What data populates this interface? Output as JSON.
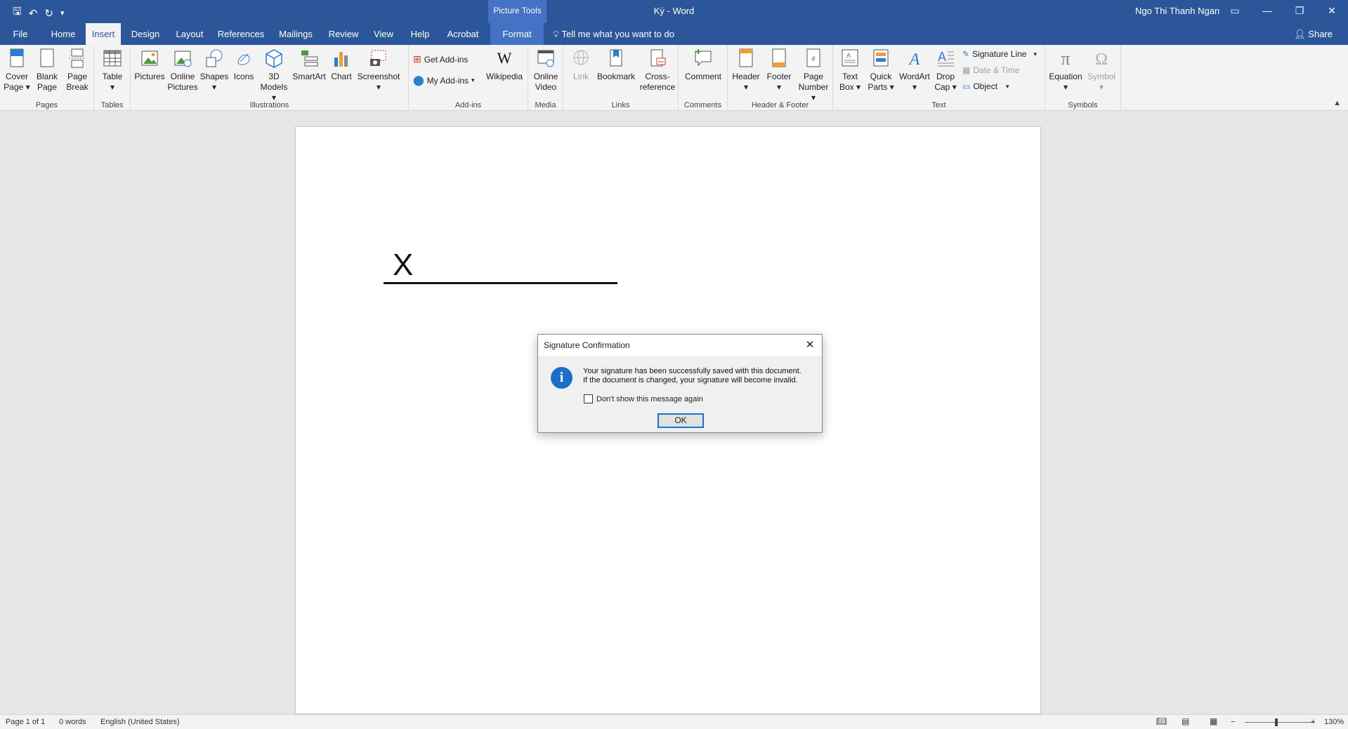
{
  "titlebar": {
    "contextual_tab_group": "Picture Tools",
    "doc_title": "Ký  -  Word",
    "user": "Ngo Thi Thanh Ngan"
  },
  "tabs": [
    "File",
    "Home",
    "Insert",
    "Design",
    "Layout",
    "References",
    "Mailings",
    "Review",
    "View",
    "Help",
    "Acrobat",
    "Format"
  ],
  "active_tab": "Insert",
  "tell_me": "Tell me what you want to do",
  "share": "Share",
  "ribbon": {
    "pages": {
      "label": "Pages",
      "cover": [
        "Cover",
        "Page"
      ],
      "blank": [
        "Blank",
        "Page"
      ],
      "break": [
        "Page",
        "Break"
      ]
    },
    "tables": {
      "label": "Tables",
      "table": "Table"
    },
    "illustrations": {
      "label": "Illustrations",
      "pictures": "Pictures",
      "online": [
        "Online",
        "Pictures"
      ],
      "shapes": "Shapes",
      "icons": "Icons",
      "models": [
        "3D",
        "Models"
      ],
      "smartart": "SmartArt",
      "chart": "Chart",
      "screenshot": "Screenshot"
    },
    "addins": {
      "label": "Add-ins",
      "get": "Get Add-ins",
      "my": "My Add-ins",
      "wikipedia": "Wikipedia"
    },
    "media": {
      "label": "Media",
      "video": [
        "Online",
        "Video"
      ]
    },
    "links": {
      "label": "Links",
      "link": "Link",
      "bookmark": "Bookmark",
      "cross": [
        "Cross-",
        "reference"
      ]
    },
    "comments": {
      "label": "Comments",
      "comment": "Comment"
    },
    "hf": {
      "label": "Header & Footer",
      "header": "Header",
      "footer": "Footer",
      "pagenum": [
        "Page",
        "Number"
      ]
    },
    "text": {
      "label": "Text",
      "textbox": [
        "Text",
        "Box"
      ],
      "quickparts": [
        "Quick",
        "Parts"
      ],
      "wordart": "WordArt",
      "dropcap": [
        "Drop",
        "Cap"
      ],
      "sigline": "Signature Line",
      "datetime": "Date & Time",
      "object": "Object"
    },
    "symbols": {
      "label": "Symbols",
      "equation": "Equation",
      "symbol": "Symbol"
    }
  },
  "document": {
    "signature_mark": "X"
  },
  "dialog": {
    "title": "Signature Confirmation",
    "message_line1": "Your signature has been successfully saved with this document.",
    "message_line2": "If the document is changed, your signature will become invalid.",
    "checkbox_label": "Don't show this message again",
    "checkbox_checked": false,
    "ok": "OK"
  },
  "status": {
    "page": "Page 1 of 1",
    "words": "0 words",
    "language": "English (United States)",
    "zoom": "130%"
  },
  "colors": {
    "title_blue": "#2b579a",
    "contextual_blue": "#4472c4",
    "info_blue": "#1c6fc9"
  }
}
